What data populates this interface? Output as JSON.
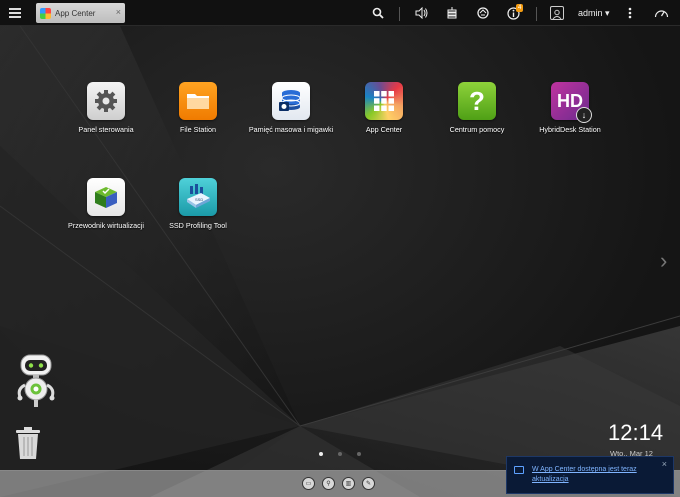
{
  "taskbar": {
    "tab_title": "App Center",
    "tab_close": "×",
    "notification_count": "4",
    "user": "admin ▾"
  },
  "apps": [
    {
      "label": "Panel sterowania",
      "icon": "gear-icon"
    },
    {
      "label": "File Station",
      "icon": "folder-icon"
    },
    {
      "label": "Pamięć masowa i migawki",
      "icon": "storage-icon"
    },
    {
      "label": "App Center",
      "icon": "app-grid-icon"
    },
    {
      "label": "Centrum pomocy",
      "icon": "help-icon"
    },
    {
      "label": "HybridDesk Station",
      "icon": "hd-icon"
    },
    {
      "label": "Przewodnik wirtualizacji",
      "icon": "virtualization-icon"
    },
    {
      "label": "SSD Profiling Tool",
      "icon": "ssd-icon"
    }
  ],
  "clock": {
    "time": "12:14",
    "date": "Wto., Mar 12"
  },
  "pages": {
    "count": 3,
    "active": 0
  },
  "notification": {
    "text": "W App Center dostępna jest teraz aktualizacja",
    "close": "×"
  },
  "colors": {
    "accent_blue": "#5ea1ff",
    "badge": "#f39c12"
  }
}
